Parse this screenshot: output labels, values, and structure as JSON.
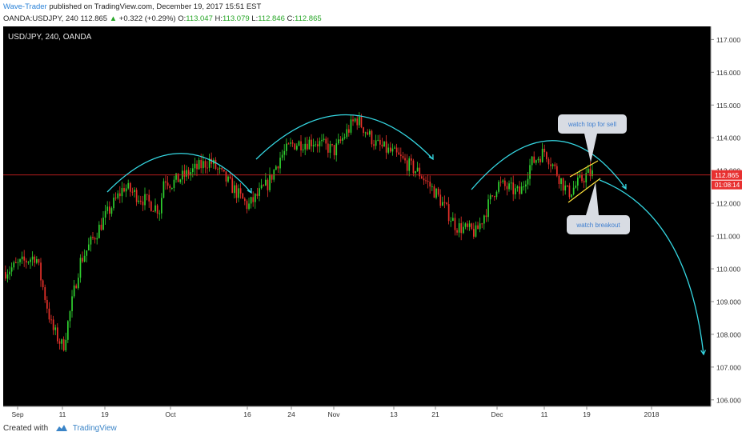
{
  "header": {
    "author": "Wave-Trader",
    "published_text": "published on TradingView.com, December 19, 2017 15:51 EST",
    "symbol": "OANDA:USDJPY, 240",
    "last": "112.865",
    "change": "+0.322 (+0.29%)",
    "o_label": "O:",
    "o_value": "113.047",
    "h_label": "H:",
    "h_value": "113.079",
    "l_label": "L:",
    "l_value": "112.846",
    "c_label": "C:",
    "c_value": "112.865"
  },
  "footer": {
    "created_with": "Created with",
    "brand": "TradingView"
  },
  "colors": {
    "background": "#000000",
    "up_candle": "#2fcf2f",
    "down_candle": "#e8312a",
    "arc": "#35d8e3",
    "channel": "#ffe23a",
    "price_line": "#cc2020",
    "price_tag": "#e83030",
    "callout": "#d8dce3",
    "callout_text": "#3f7fd0"
  },
  "chart_data": {
    "type": "candlestick",
    "title": "USD/JPY, 240, OANDA",
    "y_ticks": [
      "117.000",
      "116.000",
      "115.000",
      "114.000",
      "113.000",
      "112.000",
      "111.000",
      "110.000",
      "109.000",
      "108.000",
      "107.000",
      "106.000"
    ],
    "ylim": [
      105.8,
      117.4
    ],
    "x_ticks": [
      "Sep",
      "11",
      "19",
      "Oct",
      "16",
      "24",
      "Nov",
      "13",
      "21",
      "Dec",
      "11",
      "19",
      "2018"
    ],
    "current_price": "112.865",
    "countdown": "01:08:14",
    "price_path": [
      {
        "x": "Sep",
        "y": 109.9
      },
      {
        "x": "Sep 5",
        "y": 110.4
      },
      {
        "x": "Sep 8",
        "y": 108.2
      },
      {
        "x": "11",
        "y": 107.6
      },
      {
        "x": "Sep 14",
        "y": 110.2
      },
      {
        "x": "19",
        "y": 111.6
      },
      {
        "x": "Sep 21",
        "y": 112.5
      },
      {
        "x": "Sep 26",
        "y": 111.8
      },
      {
        "x": "Sep 28",
        "y": 112.8
      },
      {
        "x": "Oct",
        "y": 112.6
      },
      {
        "x": "Oct 6",
        "y": 113.3
      },
      {
        "x": "Oct 11",
        "y": 112.5
      },
      {
        "x": "16",
        "y": 111.9
      },
      {
        "x": "Oct 19",
        "y": 112.6
      },
      {
        "x": "Oct 22",
        "y": 113.4
      },
      {
        "x": "24",
        "y": 113.8
      },
      {
        "x": "Oct 28",
        "y": 113.9
      },
      {
        "x": "Nov",
        "y": 113.6
      },
      {
        "x": "Nov 6",
        "y": 114.6
      },
      {
        "x": "Nov 9",
        "y": 113.8
      },
      {
        "x": "13",
        "y": 113.5
      },
      {
        "x": "Nov 16",
        "y": 112.9
      },
      {
        "x": "21",
        "y": 112.3
      },
      {
        "x": "Nov 24",
        "y": 111.3
      },
      {
        "x": "Nov 27",
        "y": 111.1
      },
      {
        "x": "Dec",
        "y": 112.6
      },
      {
        "x": "Dec 5",
        "y": 112.3
      },
      {
        "x": "Dec 7",
        "y": 113.2
      },
      {
        "x": "11",
        "y": 113.6
      },
      {
        "x": "Dec 14",
        "y": 112.3
      },
      {
        "x": "19",
        "y": 112.9
      }
    ],
    "annotations": [
      {
        "text": "watch top for sell"
      },
      {
        "text": "watch breakout"
      }
    ]
  }
}
